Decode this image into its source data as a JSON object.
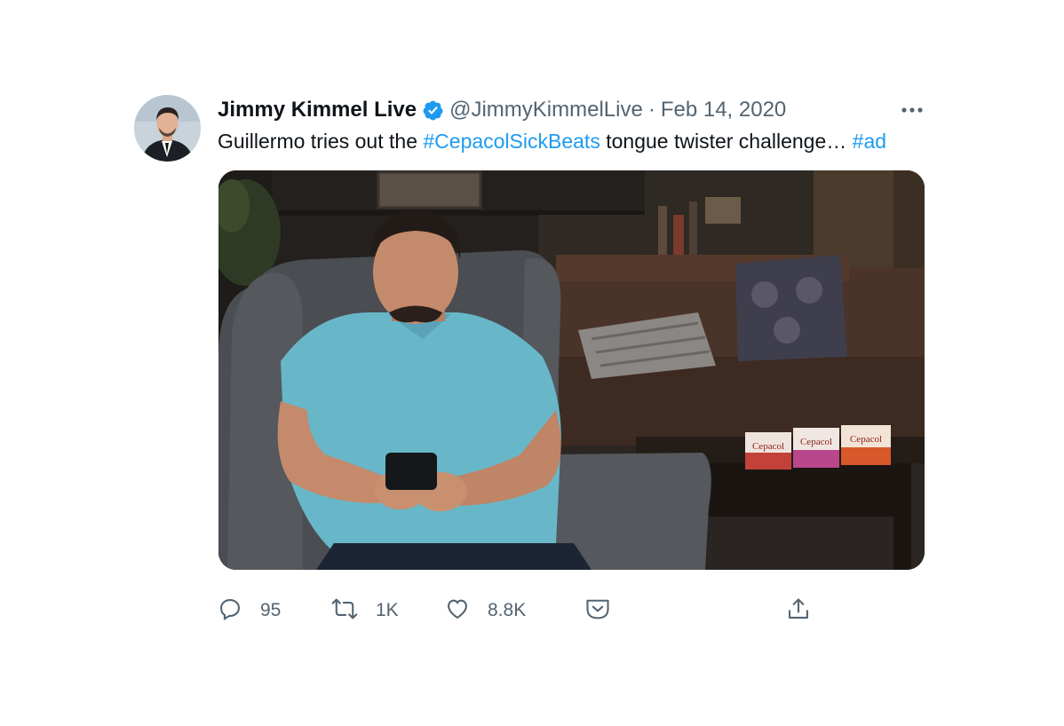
{
  "tweet": {
    "display_name": "Jimmy Kimmel Live",
    "handle": "@JimmyKimmelLive",
    "separator": "·",
    "date": "Feb 14, 2020",
    "text_prefix": "Guillermo tries out the ",
    "hashtag_1": "#CepacolSickBeats",
    "text_middle": " tongue twister challenge… ",
    "hashtag_2": "#ad",
    "accent_color": "#1d9bf0"
  },
  "media": {
    "product_label": "Cepacol"
  },
  "actions": {
    "reply_count": "95",
    "retweet_count": "1K",
    "like_count": "8.8K"
  },
  "icons": {
    "verified": "verified-badge-icon",
    "more": "more-dots-icon",
    "reply": "reply-icon",
    "retweet": "retweet-icon",
    "like": "heart-icon",
    "tip": "tip-jar-icon",
    "share": "share-icon"
  }
}
